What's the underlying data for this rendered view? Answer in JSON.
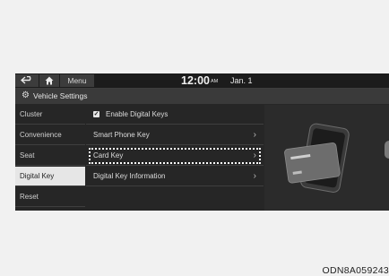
{
  "topbar": {
    "menu_label": "Menu",
    "time": "12:00",
    "ampm": "AM",
    "date": "Jan. 1",
    "icons": [
      "back-icon",
      "home-icon"
    ]
  },
  "title": {
    "icon": "gear-icon",
    "text": "Vehicle Settings"
  },
  "sidebar": {
    "items": [
      {
        "label": "Cluster"
      },
      {
        "label": "Convenience"
      },
      {
        "label": "Seat"
      },
      {
        "label": "Digital Key",
        "active": true
      },
      {
        "label": "Reset"
      }
    ]
  },
  "list": {
    "enable": {
      "label": "Enable Digital Keys",
      "checked": true
    },
    "items": [
      {
        "label": "Smart Phone Key"
      },
      {
        "label": "Card Key",
        "highlighted": true
      },
      {
        "label": "Digital Key Information"
      }
    ]
  },
  "caption": "ODN8A059243"
}
